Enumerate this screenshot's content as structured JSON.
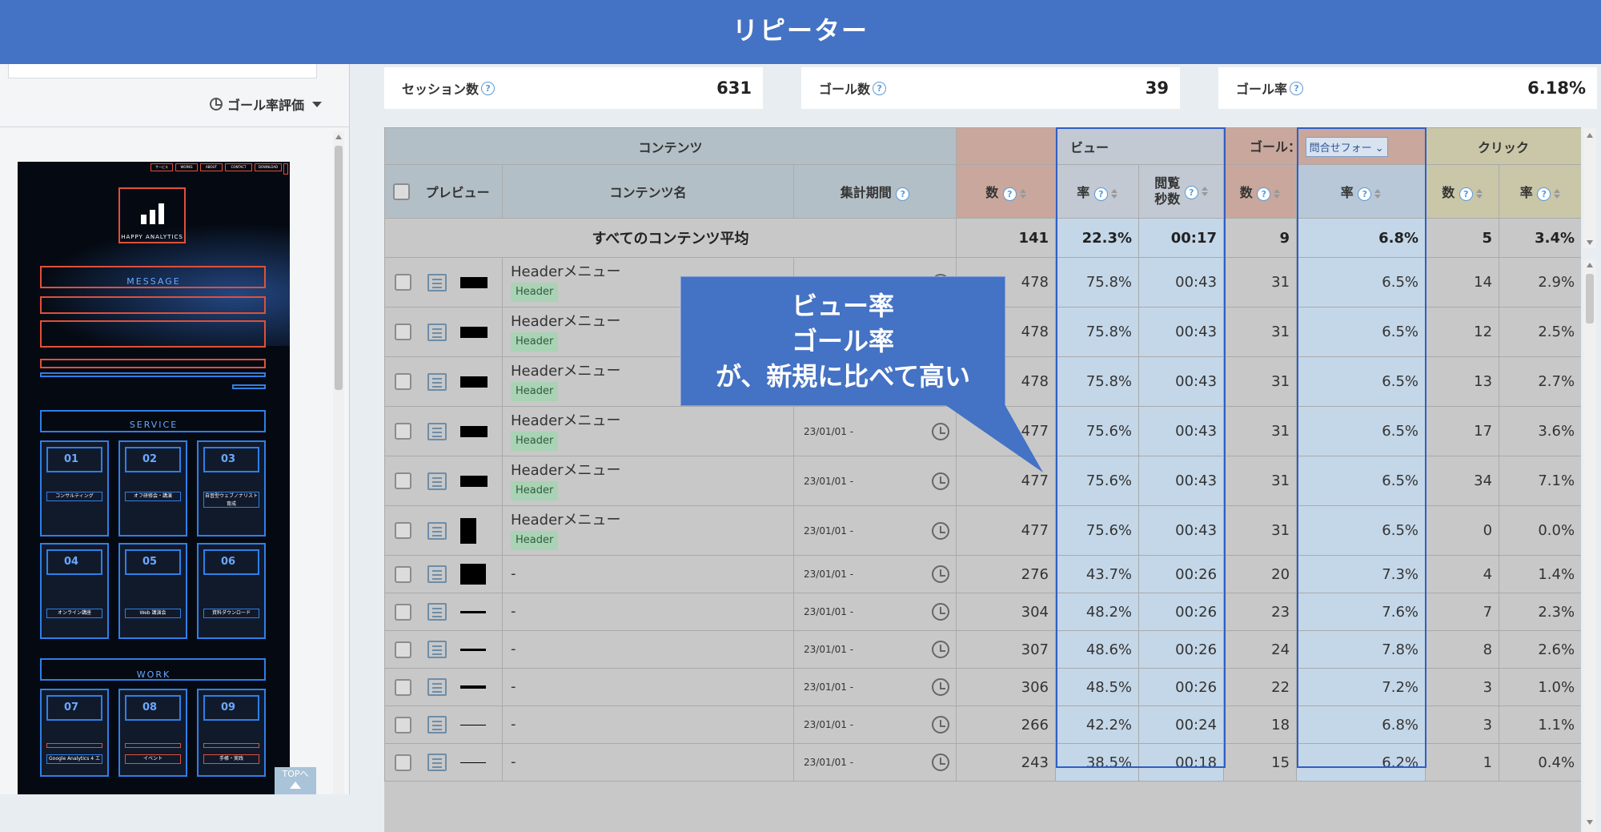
{
  "header": {
    "title": "リピーター"
  },
  "left": {
    "goal_eval_label": "ゴール率評価",
    "top_button": "TOPへ",
    "preview": {
      "nav": [
        "サービス",
        "WORKS",
        "ABOUT",
        "CONTACT",
        "DOWNLOAD"
      ],
      "logo_text": "HAPPY ANALYTICS",
      "message_title": "MESSAGE",
      "service_title": "SERVICE",
      "work_title": "WORK",
      "service_cards": [
        {
          "num": "01",
          "label": "コンサルティング"
        },
        {
          "num": "02",
          "label": "オフ研修会・講演"
        },
        {
          "num": "03",
          "label": "自習型ウェブノナリスト育成"
        },
        {
          "num": "04",
          "label": "オンライン講座"
        },
        {
          "num": "05",
          "label": "Web 講演会"
        },
        {
          "num": "06",
          "label": "資料ダウンロード"
        }
      ],
      "work_cards": [
        {
          "num": "07",
          "label": "Google Analytics 4 エヌイ"
        },
        {
          "num": "08",
          "label": "イベント"
        },
        {
          "num": "09",
          "label": "手帳・実践"
        }
      ]
    }
  },
  "summary": [
    {
      "label": "セッション数",
      "value": "631"
    },
    {
      "label": "ゴール数",
      "value": "39"
    },
    {
      "label": "ゴール率",
      "value": "6.18%"
    }
  ],
  "table": {
    "group_headers": {
      "content": "コンテンツ",
      "view": "ビュー",
      "goal": "ゴール：",
      "goal_select": "問合せフォー",
      "click": "クリック"
    },
    "col_headers": {
      "preview": "プレビュー",
      "name": "コンテンツ名",
      "period": "集計期間",
      "count": "数",
      "rate": "率",
      "browse_sec_1": "閲覧",
      "browse_sec_2": "秒数",
      "goal_count": "数",
      "goal_rate": "率",
      "click_count": "数",
      "click_rate": "率"
    },
    "average": {
      "label": "すべてのコンテンツ平均",
      "count": "141",
      "view_rate": "22.3%",
      "browse": "00:17",
      "goal_count": "9",
      "goal_rate": "6.8%",
      "click_count": "5",
      "click_rate": "3.4%"
    },
    "rows": [
      {
        "name": "Headerメニュー",
        "tag": "Header",
        "period": "",
        "count": "478",
        "view_rate": "75.8%",
        "browse": "00:43",
        "goal_count": "31",
        "goal_rate": "6.5%",
        "click_count": "14",
        "click_rate": "2.9%"
      },
      {
        "name": "Headerメニュー",
        "tag": "Header",
        "period": "",
        "count": "478",
        "view_rate": "75.8%",
        "browse": "00:43",
        "goal_count": "31",
        "goal_rate": "6.5%",
        "click_count": "12",
        "click_rate": "2.5%"
      },
      {
        "name": "Headerメニュー",
        "tag": "Header",
        "period": "",
        "count": "478",
        "view_rate": "75.8%",
        "browse": "00:43",
        "goal_count": "31",
        "goal_rate": "6.5%",
        "click_count": "13",
        "click_rate": "2.7%"
      },
      {
        "name": "Headerメニュー",
        "tag": "Header",
        "period": "23/01/01 -",
        "count": "477",
        "view_rate": "75.6%",
        "browse": "00:43",
        "goal_count": "31",
        "goal_rate": "6.5%",
        "click_count": "17",
        "click_rate": "3.6%"
      },
      {
        "name": "Headerメニュー",
        "tag": "Header",
        "period": "23/01/01 -",
        "count": "477",
        "view_rate": "75.6%",
        "browse": "00:43",
        "goal_count": "31",
        "goal_rate": "6.5%",
        "click_count": "34",
        "click_rate": "7.1%"
      },
      {
        "name": "Headerメニュー",
        "tag": "Header",
        "period": "23/01/01 -",
        "count": "477",
        "view_rate": "75.6%",
        "browse": "00:43",
        "goal_count": "31",
        "goal_rate": "6.5%",
        "click_count": "0",
        "click_rate": "0.0%"
      },
      {
        "name": "-",
        "tag": "",
        "period": "23/01/01 -",
        "count": "276",
        "view_rate": "43.7%",
        "browse": "00:26",
        "goal_count": "20",
        "goal_rate": "7.3%",
        "click_count": "4",
        "click_rate": "1.4%"
      },
      {
        "name": "-",
        "tag": "",
        "period": "23/01/01 -",
        "count": "304",
        "view_rate": "48.2%",
        "browse": "00:26",
        "goal_count": "23",
        "goal_rate": "7.6%",
        "click_count": "7",
        "click_rate": "2.3%"
      },
      {
        "name": "-",
        "tag": "",
        "period": "23/01/01 -",
        "count": "307",
        "view_rate": "48.6%",
        "browse": "00:26",
        "goal_count": "24",
        "goal_rate": "7.8%",
        "click_count": "8",
        "click_rate": "2.6%"
      },
      {
        "name": "-",
        "tag": "",
        "period": "23/01/01 -",
        "count": "306",
        "view_rate": "48.5%",
        "browse": "00:26",
        "goal_count": "22",
        "goal_rate": "7.2%",
        "click_count": "3",
        "click_rate": "1.0%"
      },
      {
        "name": "-",
        "tag": "",
        "period": "23/01/01 -",
        "count": "266",
        "view_rate": "42.2%",
        "browse": "00:24",
        "goal_count": "18",
        "goal_rate": "6.8%",
        "click_count": "3",
        "click_rate": "1.1%"
      },
      {
        "name": "-",
        "tag": "",
        "period": "23/01/01 -",
        "count": "243",
        "view_rate": "38.5%",
        "browse": "00:18",
        "goal_count": "15",
        "goal_rate": "6.2%",
        "click_count": "1",
        "click_rate": "0.4%"
      }
    ]
  },
  "callout": {
    "line1": "ビュー率",
    "line2": "ゴール率",
    "line3": "が、新規に比べて高い"
  },
  "colors": {
    "brand": "#4472c4",
    "goal_rate_text": "#b24a4a",
    "highlight_frame": "#2f5fc4"
  }
}
